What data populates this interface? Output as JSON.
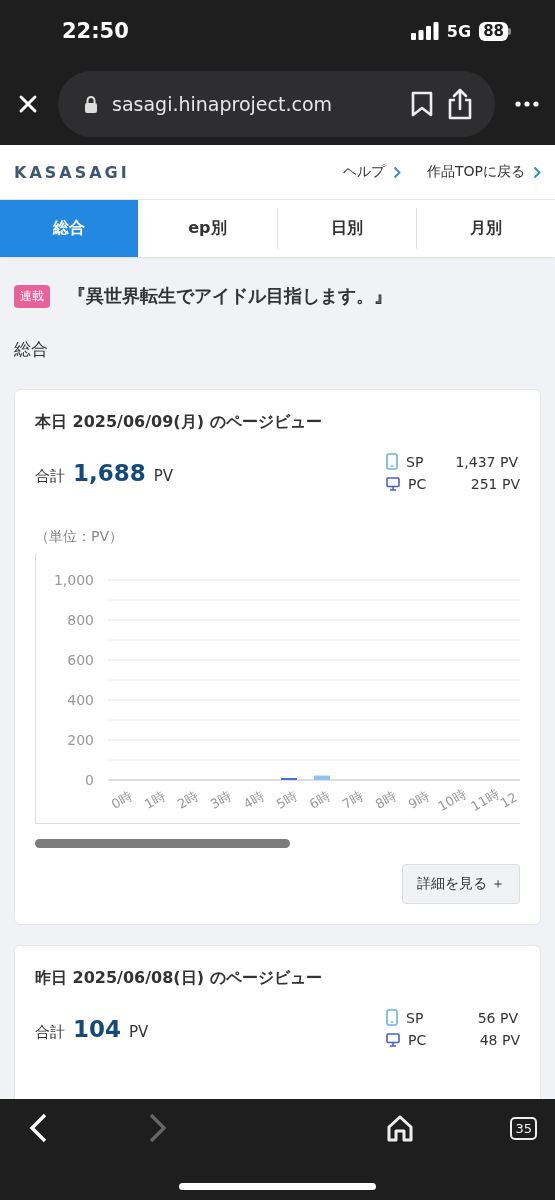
{
  "status_bar": {
    "time": "22:50",
    "network": "5G",
    "battery": "88"
  },
  "browser": {
    "url": "sasagi.hinaproject.com"
  },
  "site_header": {
    "logo": "KASASAGI",
    "links": [
      "ヘルプ",
      "作品TOPに戻る"
    ]
  },
  "tabs": [
    {
      "label": "総合",
      "selected": true
    },
    {
      "label": "ep別",
      "selected": false
    },
    {
      "label": "日別",
      "selected": false
    },
    {
      "label": "月別",
      "selected": false
    }
  ],
  "work": {
    "badge": "連載",
    "title": "『異世界転生でアイドル目指します。』"
  },
  "section_title": "総合",
  "cards": [
    {
      "title": "本日 2025/06/09(月) のページビュー",
      "total_label": "合計",
      "total": "1,688",
      "unit": "PV",
      "breakdown": [
        {
          "kind": "sp",
          "label": "SP",
          "value": "1,437 PV"
        },
        {
          "kind": "pc",
          "label": "PC",
          "value": "251 PV"
        }
      ],
      "chart_unit": "（単位：PV）",
      "chart_data": {
        "type": "bar",
        "stacked": true,
        "grid": true,
        "categories": [
          "0時",
          "1時",
          "2時",
          "3時",
          "4時",
          "5時",
          "6時",
          "7時",
          "8時",
          "9時",
          "10時",
          "11時",
          "12"
        ],
        "ylim": [
          0,
          1000
        ],
        "yticks": [
          {
            "value": 0,
            "label": "0"
          },
          {
            "value": 200,
            "label": "200"
          },
          {
            "value": 400,
            "label": "400"
          },
          {
            "value": 600,
            "label": "600"
          },
          {
            "value": 800,
            "label": "800"
          },
          {
            "value": 1000,
            "label": "1,000"
          }
        ],
        "series": [
          {
            "color": "#90c4ec",
            "values": [
              0,
              0,
              0,
              0,
              0,
              0,
              22,
              0,
              0,
              0,
              null,
              0,
              null
            ]
          },
          {
            "color": "#4a6fc4",
            "values": [
              0,
              0,
              0,
              0,
              0,
              10,
              0,
              0,
              0,
              0,
              0,
              0,
              null
            ]
          }
        ]
      },
      "button": "詳細を見る ＋"
    },
    {
      "title": "昨日 2025/06/08(日) のページビュー",
      "total_label": "合計",
      "total": "104",
      "unit": "PV",
      "breakdown": [
        {
          "kind": "sp",
          "label": "SP",
          "value": "56 PV"
        },
        {
          "kind": "pc",
          "label": "PC",
          "value": "48 PV"
        }
      ]
    }
  ],
  "bottom_toolbar": {
    "back_disabled": false,
    "forward_disabled": true,
    "tab_count": "35"
  }
}
